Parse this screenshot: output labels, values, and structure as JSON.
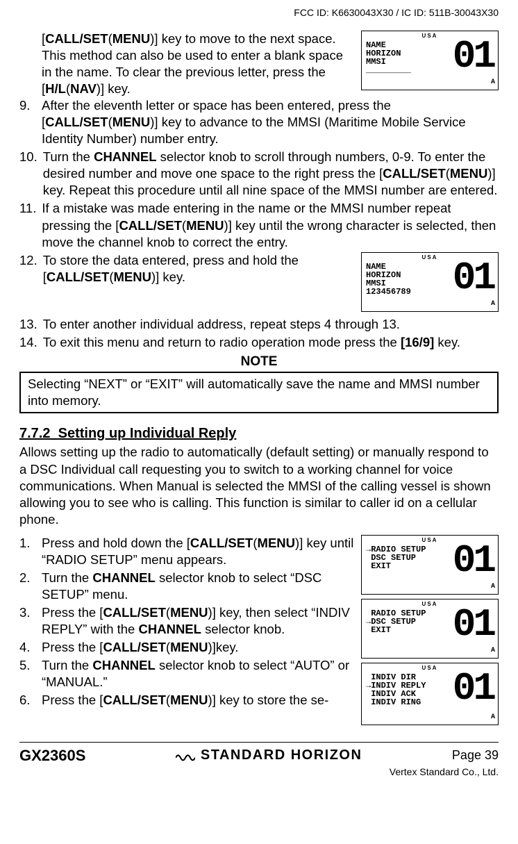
{
  "header": {
    "fcc_id": "FCC ID: K6630043X30 / IC ID: 511B-30043X30"
  },
  "screens": {
    "s1": {
      "usa": "USA",
      "lines": "NAME\nHORIZON\nMMSI\n_________",
      "digits": "01",
      "sub": "A"
    },
    "s2": {
      "usa": "USA",
      "lines": "NAME\nHORIZON\nMMSI\n123456789",
      "digits": "01",
      "sub": "A"
    },
    "s3": {
      "usa": "USA",
      "lines": "→RADIO SETUP\n DSC SETUP\n EXIT",
      "digits": "01",
      "sub": "A"
    },
    "s4": {
      "usa": "USA",
      "lines": " RADIO SETUP\n→DSC SETUP\n EXIT",
      "digits": "01",
      "sub": "A"
    },
    "s5": {
      "usa": "USA",
      "lines": " INDIV DIR\n→INDIV REPLY\n INDIV ACK\n INDIV RING",
      "digits": "01",
      "sub": "A"
    }
  },
  "keys": {
    "call_set_menu_open": "[",
    "call_set_menu_txt": "CALL/SET",
    "call_set_menu_paren_l": "(",
    "call_set_menu_menu": "MENU",
    "call_set_menu_paren_r": ")",
    "call_set_menu_close": "]",
    "hl_nav_open": "[",
    "hl_nav_txt": "H/L",
    "hl_nav_paren_l": "(",
    "hl_nav_nav": "NAV",
    "hl_nav_paren_r": ")",
    "hl_nav_close": "]",
    "sixteen_nine": "[16/9]",
    "channel": "CHANNEL"
  },
  "list_top": {
    "pre": {
      "p1a": " key to move to the next space. This method can also be used to enter a blank space in the name. To clear the previous letter, press the ",
      "p1c": " key."
    },
    "i9_num": "9.",
    "i9_a": "After the eleventh letter or space has been entered, press the ",
    "i9_c": " key to advance to the MMSI (Maritime Mobile Service Identity Number) number entry.",
    "i10_num": "10.",
    "i10_a": "Turn the ",
    "i10_b": " selector knob to scroll through numbers, 0-9. To enter the desired number and move one space to the right press the ",
    "i10_d": " key. Repeat this procedure until all nine space of the MMSI number are entered.",
    "i11_num": "11.",
    "i11_a": "If a mistake was made entering in the name or the MMSI number repeat pressing the ",
    "i11_c": " key until the wrong character is selected, then move the channel knob to correct the entry.",
    "i12_num": "12.",
    "i12_a": "To store the data entered, press and hold the ",
    "i12_c": " key.",
    "i13_num": "13.",
    "i13_a": "To enter another individual address, repeat steps 4 through 13.",
    "i14_num": "14.",
    "i14_a": "To exit this menu and return to radio operation mode press the ",
    "i14_c": " key."
  },
  "note": {
    "title": "NOTE",
    "text": "Selecting “NEXT” or “EXIT” will automatically save the name and MMSI number into memory."
  },
  "section": {
    "num": "7.7.2",
    "title": "Setting up Individual Reply",
    "intro": "Allows setting up the radio to automatically (default setting) or manually respond to a DSC Individual call requesting you to switch to a working channel for voice communications. When Manual is selected the MMSI of the calling vessel is shown allowing you to see who is calling. This function is similar to caller id on a cellular phone."
  },
  "list_bottom": {
    "i1_num": "1.",
    "i1_a": "Press and hold down the ",
    "i1_c": " key until “RADIO SETUP” menu appears.",
    "i2_num": "2.",
    "i2_a": "Turn the ",
    "i2_c": " selector knob to select “DSC SETUP” menu.",
    "i3_num": "3.",
    "i3_a": "Press the ",
    "i3_c": " key, then select “INDIV REPLY” with the ",
    "i3_e": " selector knob.",
    "i4_num": "4.",
    "i4_a": "Press the ",
    "i4_c": "key.",
    "i5_num": "5.",
    "i5_a": "Turn the ",
    "i5_c": " selector knob to select “AUTO” or “MANUAL.”",
    "i6_num": "6.",
    "i6_a": "Press the ",
    "i6_c": " key to store the se-"
  },
  "footer": {
    "model": "GX2360S",
    "brand": "STANDARD HORIZON",
    "page": "Page 39",
    "vendor": "Vertex Standard Co., Ltd."
  }
}
